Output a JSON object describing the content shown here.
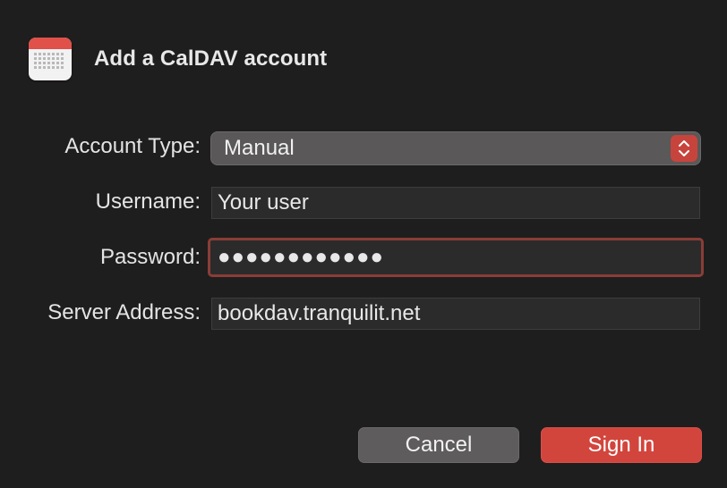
{
  "dialog": {
    "title": "Add a CalDAV account",
    "icon": "calendar-icon"
  },
  "form": {
    "account_type": {
      "label": "Account Type:",
      "value": "Manual"
    },
    "username": {
      "label": "Username:",
      "value": "Your user"
    },
    "password": {
      "label": "Password:",
      "value": "●●●●●●●●●●●●"
    },
    "server_address": {
      "label": "Server Address:",
      "value": "bookdav.tranquilit.net"
    }
  },
  "buttons": {
    "cancel": "Cancel",
    "sign_in": "Sign In"
  },
  "colors": {
    "background": "#1f1e1e",
    "accent": "#d2453d",
    "focus_ring": "#8a3d37",
    "field": "#2c2b2b"
  }
}
